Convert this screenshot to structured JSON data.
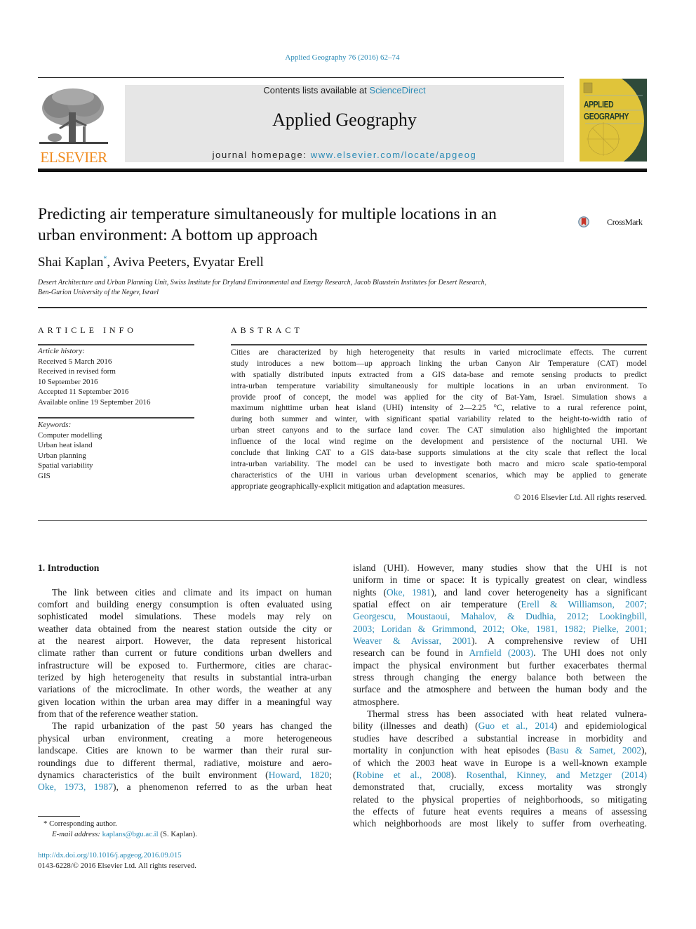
{
  "journal_citation": "Applied Geography 76 (2016) 62–74",
  "header": {
    "contents_prefix": "Contents lists available at ",
    "contents_link": "ScienceDirect",
    "journal_title": "Applied Geography",
    "homepage_prefix": "journal homepage: ",
    "homepage_link": "www.elsevier.com/locate/apgeog",
    "publisher_logo_text": "ELSEVIER",
    "cover_line1": "APPLIED",
    "cover_line2": "GEOGRAPHY"
  },
  "colors": {
    "link": "#2a8ab5",
    "elsevier_orange": "#f08a1c",
    "header_bg": "#e6e6e6",
    "cover_yellow": "#e0c43a",
    "cover_green": "#2f4a3a",
    "crossmark_red": "#c8352a"
  },
  "article": {
    "title_line1": "Predicting air temperature simultaneously for multiple locations in an",
    "title_line2": "urban environment: A bottom up approach",
    "crossmark_label": "CrossMark",
    "authors": [
      {
        "name": "Shai Kaplan",
        "mark": "*"
      },
      {
        "name": "Aviva Peeters",
        "mark": ""
      },
      {
        "name": "Evyatar Erell",
        "mark": ""
      }
    ],
    "author_separator": ", ",
    "affiliation_line1": "Desert Architecture and Urban Planning Unit, Swiss Institute for Dryland Environmental and Energy Research, Jacob Blaustein Institutes for Desert Research,",
    "affiliation_line2": "Ben-Gurion University of the Negev, Israel"
  },
  "article_info": {
    "heading": "ARTICLE INFO",
    "history_label": "Article history:",
    "history": [
      "Received 5 March 2016",
      "Received in revised form",
      "10 September 2016",
      "Accepted 11 September 2016",
      "Available online 19 September 2016"
    ],
    "keywords_label": "Keywords:",
    "keywords": [
      "Computer modelling",
      "Urban heat island",
      "Urban planning",
      "Spatial variability",
      "GIS"
    ]
  },
  "abstract": {
    "heading": "ABSTRACT",
    "lines": [
      "Cities are characterized by high heterogeneity that results in varied microclimate effects. The current",
      "study introduces a new bottom—up approach linking the urban Canyon Air Temperature (CAT) model",
      "with spatially distributed inputs extracted from a GIS data-base and remote sensing products to predict",
      "intra-urban temperature variability simultaneously for multiple locations in an urban environment. To",
      "provide proof of concept, the model was applied for the city of Bat-Yam, Israel. Simulation shows a",
      "maximum nighttime urban heat island (UHI) intensity of 2—2.25 °C, relative to a rural reference point,",
      "during both summer and winter, with significant spatial variability related to the height-to-width ratio of",
      "urban street canyons and to the surface land cover. The CAT simulation also highlighted the important",
      "influence of the local wind regime on the development and persistence of the nocturnal UHI. We",
      "conclude that linking CAT to a GIS data-base supports simulations at the city scale that reflect the local",
      "intra-urban variability. The model can be used to investigate both macro and micro scale spatio-temporal",
      "characteristics of the UHI in various urban development scenarios, which may be applied to generate",
      "appropriate geographically-explicit mitigation and adaptation measures."
    ],
    "copyright": "© 2016 Elsevier Ltd. All rights reserved."
  },
  "body": {
    "section_title": "1.  Introduction",
    "left_lines": [
      {
        "t": "The link between cities and climate and its impact on human",
        "indent": true
      },
      {
        "t": "comfort and building energy consumption is often evaluated using"
      },
      {
        "t": "sophisticated model simulations. These models may rely on"
      },
      {
        "t": "weather data obtained from the nearest station outside the city or"
      },
      {
        "t": "at the nearest airport. However, the data represent historical"
      },
      {
        "t": "climate rather than current or future conditions urban dwellers and"
      },
      {
        "t": "infrastructure will be exposed to. Furthermore, cities are charac-"
      },
      {
        "t": "terized by high heterogeneity that results in substantial intra-urban"
      },
      {
        "t": "variations of the microclimate. In other words, the weather at any"
      },
      {
        "t": "given location within the urban area may differ in a meaningful way"
      },
      {
        "t": "from that of the reference weather station.",
        "last": true
      },
      {
        "t": "The rapid urbanization of the past 50 years has changed the",
        "indent": true
      },
      {
        "t": "physical urban environment, creating a more heterogeneous"
      },
      {
        "t": "landscape. Cities are known to be warmer than their rural sur-"
      },
      {
        "t": "roundings due to different thermal, radiative, moisture and aero-"
      }
    ],
    "left_line16_pre": "dynamics characteristics of the built environment (",
    "left_line16_link": "Howard, 1820",
    "left_line16_post": ";",
    "left_line17_link": "Oke, 1973, 1987",
    "left_line17_post": "), a phenomenon referred to as the urban heat",
    "right": {
      "l1": "island (UHI). However, many studies show that the UHI is not",
      "l2": "uniform in time or space: It is typically greatest on clear, windless",
      "l3_pre": "nights (",
      "l3_link": "Oke, 1981",
      "l3_post": "), and land cover heterogeneity has a significant",
      "l4_pre": "spatial effect on air temperature (",
      "l4_link": "Erell & Williamson, 2007;",
      "l5_link": "Georgescu, Moustaoui, Mahalov, & Dudhia, 2012; Lookingbill,",
      "l6_link": "2003; Loridan & Grimmond, 2012; Oke, 1981, 1982; Pielke, 2001;",
      "l7_link": "Weaver & Avissar, 2001",
      "l7_post": "). A comprehensive review of UHI",
      "l8_pre": "research can be found in ",
      "l8_link": "Arnfield (2003)",
      "l8_post": ". The UHI does not only",
      "l9": "impact the physical environment but further exacerbates thermal",
      "l10": "stress through changing the energy balance both between the",
      "l11": "surface and the atmosphere and between the human body and the",
      "l12": "atmosphere.",
      "l13": "Thermal stress has been associated with heat related vulnera-",
      "l14_pre": "bility (illnesses and death) (",
      "l14_link": "Guo et al., 2014",
      "l14_post": ") and epidemiological",
      "l15": "studies have described a substantial increase in morbidity and",
      "l16_pre": "mortality in conjunction with heat episodes (",
      "l16_link": "Basu & Samet, 2002",
      "l16_post": "),",
      "l17": "of which the 2003 heat wave in Europe is a well-known example",
      "l18_pre": "(",
      "l18_link1": "Robine et al., 2008",
      "l18_mid": "). ",
      "l18_link2": "Rosenthal, Kinney, and Metzger (2014)",
      "l19": "demonstrated that, crucially, excess mortality was strongly",
      "l20": "related to the physical properties of neighborhoods, so mitigating",
      "l21": "the effects of future heat events requires a means of assessing",
      "l22": "which neighborhoods are most likely to suffer from overheating."
    }
  },
  "footnote": {
    "marker": "*",
    "corresponding": "Corresponding author.",
    "email_label": "E-mail address: ",
    "email": "kaplans@bgu.ac.il",
    "email_suffix": " (S. Kaplan)."
  },
  "doi": {
    "link": "http://dx.doi.org/10.1016/j.apgeog.2016.09.015",
    "issn_copyright": "0143-6228/© 2016 Elsevier Ltd. All rights reserved."
  }
}
